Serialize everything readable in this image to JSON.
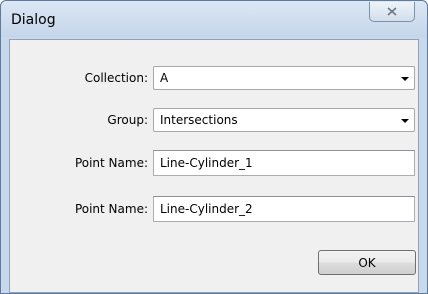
{
  "window": {
    "title": "Dialog",
    "close_icon": "close-x-icon"
  },
  "form": {
    "collection": {
      "label": "Collection:",
      "value": "A"
    },
    "group": {
      "label": "Group:",
      "value": "Intersections"
    },
    "point_name_1": {
      "label": "Point Name:",
      "value": "Line-Cylinder_1"
    },
    "point_name_2": {
      "label": "Point Name:",
      "value": "Line-Cylinder_2"
    }
  },
  "buttons": {
    "ok_label": "OK"
  }
}
